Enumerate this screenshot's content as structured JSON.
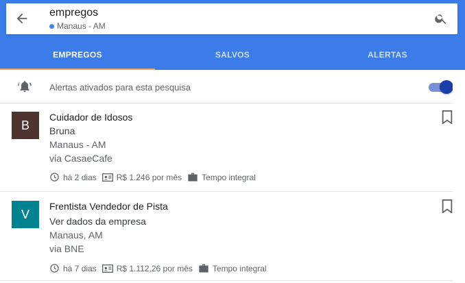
{
  "search": {
    "query": "empregos",
    "location": "Manaus - AM"
  },
  "tabs": [
    {
      "label": "EMPREGOS",
      "active": true
    },
    {
      "label": "SALVOS",
      "active": false
    },
    {
      "label": "ALERTAS",
      "active": false
    }
  ],
  "alert": {
    "text": "Alertas ativados para esta pesquisa",
    "enabled": true
  },
  "jobs": [
    {
      "logo_letter": "B",
      "logo_color": "#4e342e",
      "title": "Cuidador de Idosos",
      "company": "Bruna",
      "location": "Manaus - AM",
      "via": "via CasaeCafe",
      "posted": "há 2 dias",
      "salary": "R$ 1.246 por mês",
      "type": "Tempo integral"
    },
    {
      "logo_letter": "V",
      "logo_color": "#00838f",
      "title": "Frentista Vendedor de Pista",
      "company": "Ver dados da empresa",
      "location": "Manaus, AM",
      "via": "via BNE",
      "posted": "há 7 dias",
      "salary": "R$ 1.112,26 por mês",
      "type": "Tempo integral"
    }
  ],
  "colors": {
    "header": "#3b7ce8",
    "tab_indicator": "#f4a261",
    "toggle_thumb": "#1a3fa8"
  }
}
